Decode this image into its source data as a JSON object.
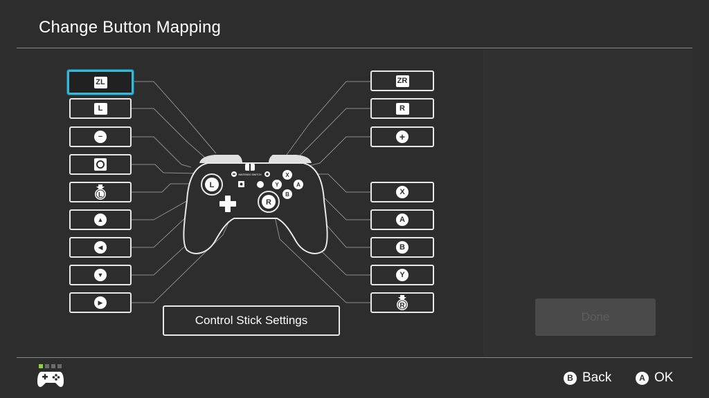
{
  "header": {
    "title": "Change Button Mapping"
  },
  "left_buttons": [
    {
      "id": "zl",
      "label": "ZL",
      "shape": "square"
    },
    {
      "id": "l",
      "label": "L",
      "shape": "square"
    },
    {
      "id": "minus",
      "label": "−",
      "shape": "circle"
    },
    {
      "id": "capture",
      "label": "",
      "shape": "capture"
    },
    {
      "id": "lstick",
      "label": "L",
      "shape": "stick"
    },
    {
      "id": "dpad-up",
      "label": "▲",
      "shape": "circle"
    },
    {
      "id": "dpad-left",
      "label": "◀",
      "shape": "circle"
    },
    {
      "id": "dpad-down",
      "label": "▼",
      "shape": "circle"
    },
    {
      "id": "dpad-right",
      "label": "▶",
      "shape": "circle"
    }
  ],
  "right_buttons": [
    {
      "id": "zr",
      "label": "ZR",
      "shape": "square"
    },
    {
      "id": "r",
      "label": "R",
      "shape": "square"
    },
    {
      "id": "plus",
      "label": "+",
      "shape": "circle"
    },
    {
      "id": "x",
      "label": "X",
      "shape": "circle"
    },
    {
      "id": "a",
      "label": "A",
      "shape": "circle"
    },
    {
      "id": "b",
      "label": "B",
      "shape": "circle"
    },
    {
      "id": "y",
      "label": "Y",
      "shape": "circle"
    },
    {
      "id": "rstick",
      "label": "R",
      "shape": "stick"
    }
  ],
  "selected_button": "zl",
  "stick_settings_label": "Control Stick Settings",
  "done_label": "Done",
  "controller": {
    "brand_text": "NINTENDO SWITCH",
    "face_labels": {
      "x": "X",
      "y": "Y",
      "a": "A",
      "b": "B"
    },
    "stick_labels": {
      "left": "L",
      "right": "R"
    }
  },
  "footer": {
    "pager_active": 1,
    "pager_total": 4,
    "back_glyph": "B",
    "back_label": "Back",
    "ok_glyph": "A",
    "ok_label": "OK"
  },
  "colors": {
    "background": "#2d2d2d",
    "selection": "#3ab5d6",
    "pager_active": "#8cd23c"
  }
}
